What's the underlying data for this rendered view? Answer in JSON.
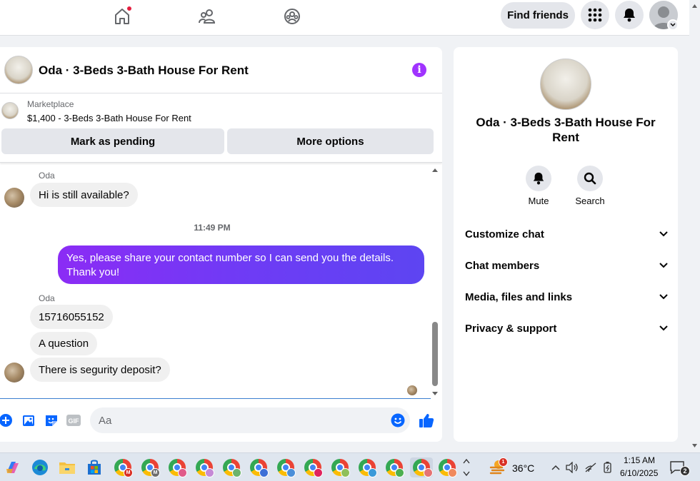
{
  "topnav": {
    "find_friends": "Find friends",
    "icons": [
      "home-icon",
      "friends-icon",
      "groups-icon",
      "menu-grid-icon",
      "notifications-icon",
      "profile-icon"
    ]
  },
  "chat": {
    "title": "Oda · 3-Beds 3-Bath House For Rent",
    "marketplace_label": "Marketplace",
    "listing": "$1,400 - 3-Beds 3-Bath House For Rent",
    "mark_pending": "Mark as pending",
    "more_options": "More options",
    "messages": [
      {
        "sender": "Oda",
        "text": "Hi is still available?"
      },
      {
        "timestamp": "11:49 PM"
      },
      {
        "sender": "me",
        "text": "Yes, please share your contact number so I can send you the details. Thank you!"
      },
      {
        "sender": "Oda",
        "text": "15716055152"
      },
      {
        "sender": "Oda",
        "text": "A question"
      },
      {
        "sender": "Oda",
        "text": "There is segurity deposit?"
      }
    ],
    "composer_placeholder": "Aa"
  },
  "side": {
    "title": "Oda · 3-Beds 3-Bath House For Rent",
    "mute": "Mute",
    "search": "Search",
    "sections": [
      "Customize chat",
      "Chat members",
      "Media, files and links",
      "Privacy & support"
    ]
  },
  "taskbar": {
    "temperature": "36°C",
    "time": "1:15 AM",
    "date": "6/10/2025",
    "notification_count": "2",
    "weather_badge": "1"
  },
  "colors": {
    "accent_purple": "#7a2bf5",
    "messenger_blue": "#0866ff",
    "nav_dot": "#e41e3f"
  }
}
